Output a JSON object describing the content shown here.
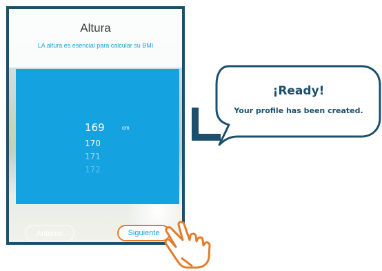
{
  "screen": {
    "title": "Altura",
    "subtitle": "LA altura es esencial para calcular su BMI"
  },
  "picker": {
    "selected_value": "169",
    "unit": "cm",
    "next_values": [
      "170",
      "171",
      "172"
    ]
  },
  "buttons": {
    "previous_label": "Anterior",
    "next_label": "Siguiente"
  },
  "callout": {
    "heading": "¡Ready!",
    "message": "Your profile has been created."
  },
  "icons": {
    "pointer": "pointing-hand-icon",
    "connector": "corner-arrow-icon"
  },
  "colors": {
    "accent_blue": "#15a2e0",
    "dark_teal": "#1b4f6b",
    "orange": "#e37b2a"
  }
}
